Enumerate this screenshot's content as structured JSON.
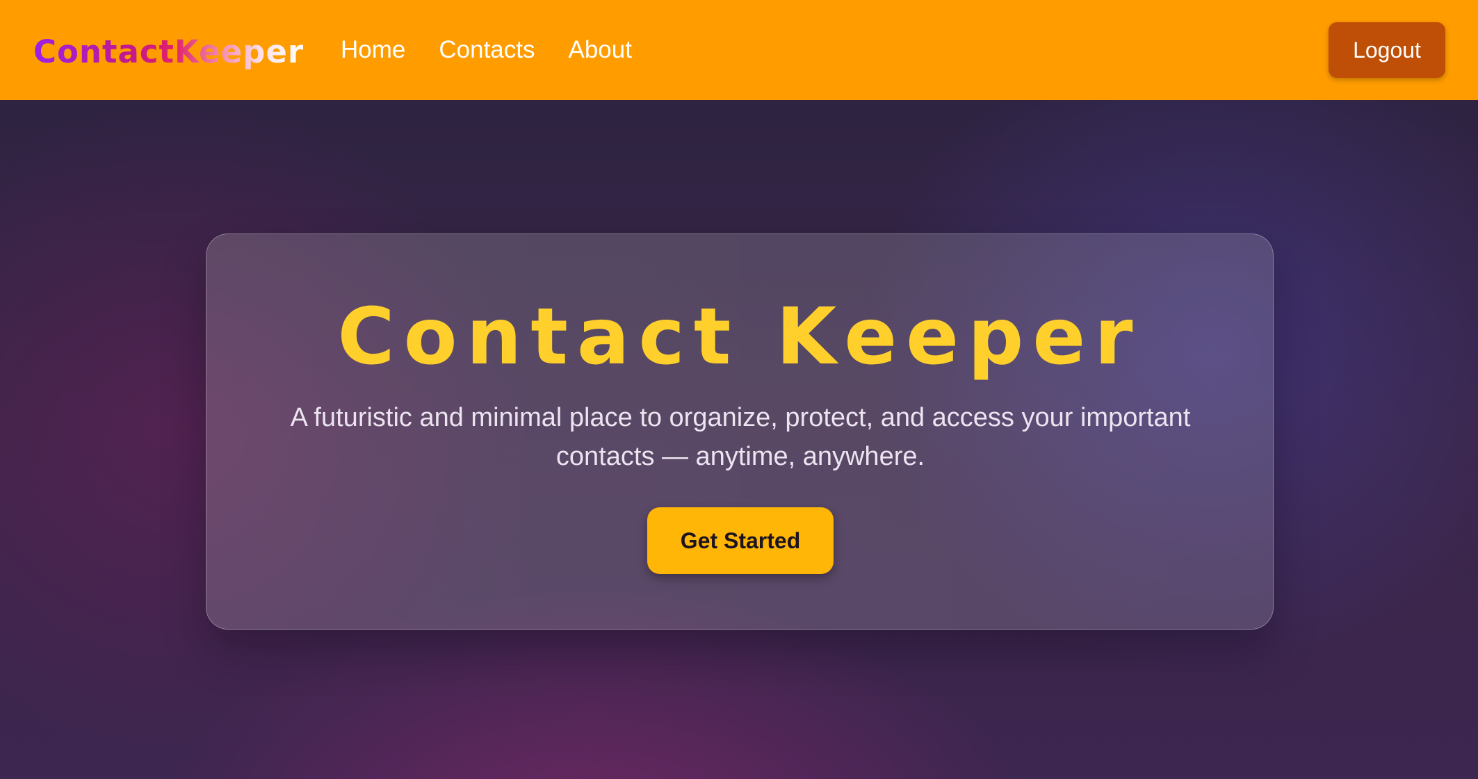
{
  "navbar": {
    "brand": "ContactKeeper",
    "links": [
      {
        "label": "Home"
      },
      {
        "label": "Contacts"
      },
      {
        "label": "About"
      }
    ],
    "logout_label": "Logout"
  },
  "hero": {
    "title": "Contact Keeper",
    "subtitle": "A futuristic and minimal place to organize, protect, and access your important contacts — anytime, anywhere.",
    "cta_label": "Get Started"
  },
  "colors": {
    "navbar_bg": "#ff9d00",
    "logout_bg": "#bf4e06",
    "title_color": "#ffd02b",
    "cta_bg": "#ffb606"
  }
}
